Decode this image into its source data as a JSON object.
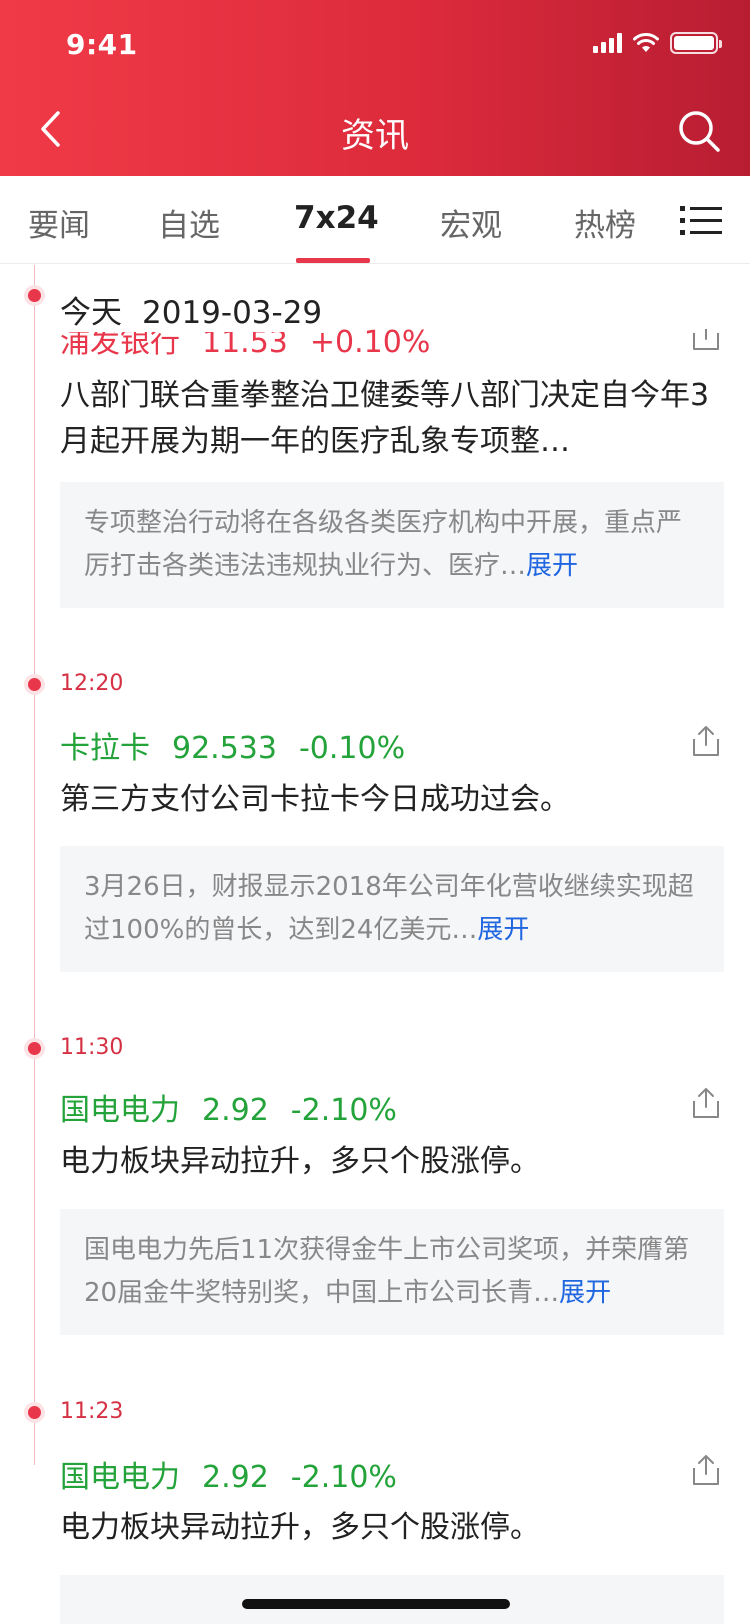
{
  "status_bar": {
    "time": "9:41"
  },
  "header": {
    "title": "资讯"
  },
  "tabs": [
    {
      "label": "要闻"
    },
    {
      "label": "自选"
    },
    {
      "label": "7x24"
    },
    {
      "label": "宏观"
    },
    {
      "label": "热榜"
    }
  ],
  "active_tab": "7x24",
  "feed": {
    "date_label": "今天",
    "date": "2019-03-29",
    "items": [
      {
        "time": "",
        "stock_name": "浦发银行",
        "price": "11.53",
        "change": "+0.10%",
        "trend": "up",
        "title": "八部门联合重拳整治卫健委等八部门决定自今年3月起开展为期一年的医疗乱象专项整…",
        "summary": "专项整治行动将在各级各类医疗机构中开展，重点严厉打击各类违法违规执业行为、医疗…",
        "more": "展开"
      },
      {
        "time": "12:20",
        "stock_name": "卡拉卡",
        "price": "92.533",
        "change": "-0.10%",
        "trend": "down",
        "title": "第三方支付公司卡拉卡今日成功过会。",
        "summary": "3月26日，财报显示2018年公司年化营收继续实现超过100%的曾长，达到24亿美元…",
        "more": "展开"
      },
      {
        "time": "11:30",
        "stock_name": "国电电力",
        "price": "2.92",
        "change": "-2.10%",
        "trend": "down",
        "title": "电力板块异动拉升，多只个股涨停。",
        "summary": "国电电力先后11次获得金牛上市公司奖项，并荣膺第20届金牛奖特别奖，中国上市公司长青…",
        "more": "展开"
      },
      {
        "time": "11:23",
        "stock_name": "国电电力",
        "price": "2.92",
        "change": "-2.10%",
        "trend": "down",
        "title": "电力板块异动拉升，多只个股涨停。"
      }
    ]
  },
  "colors": {
    "brand_red": "#e8364a",
    "up": "#e8364a",
    "down": "#23a33a",
    "link": "#1f66e0"
  }
}
